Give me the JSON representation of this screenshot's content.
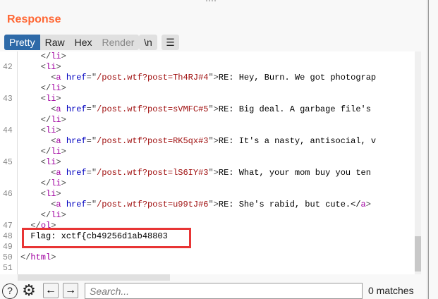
{
  "title": "Response",
  "tabs": [
    {
      "label": "Pretty",
      "state": "active"
    },
    {
      "label": "Raw",
      "state": "normal"
    },
    {
      "label": "Hex",
      "state": "normal"
    },
    {
      "label": "Render",
      "state": "disabled"
    }
  ],
  "newline_button": "\\n",
  "menu_icon": "hamburger-menu-icon",
  "lines": [
    {
      "num": "",
      "seg": [
        [
          "p",
          "    </"
        ],
        [
          "tag",
          "li"
        ],
        [
          "p",
          ">"
        ]
      ]
    },
    {
      "num": "42",
      "seg": [
        [
          "p",
          "    <"
        ],
        [
          "tag",
          "li"
        ],
        [
          "p",
          ">"
        ]
      ]
    },
    {
      "num": "",
      "seg": [
        [
          "p",
          "      <"
        ],
        [
          "tag",
          "a"
        ],
        [
          "p",
          " "
        ],
        [
          "attr",
          "href"
        ],
        [
          "p",
          "=\""
        ],
        [
          "str",
          "/post.wtf?post=Th4RJ#4"
        ],
        [
          "p",
          "\">"
        ],
        [
          "txt",
          "RE: Hey, Burn. We got photograp"
        ]
      ]
    },
    {
      "num": "",
      "seg": [
        [
          "p",
          "    </"
        ],
        [
          "tag",
          "li"
        ],
        [
          "p",
          ">"
        ]
      ]
    },
    {
      "num": "43",
      "seg": [
        [
          "p",
          "    <"
        ],
        [
          "tag",
          "li"
        ],
        [
          "p",
          ">"
        ]
      ]
    },
    {
      "num": "",
      "seg": [
        [
          "p",
          "      <"
        ],
        [
          "tag",
          "a"
        ],
        [
          "p",
          " "
        ],
        [
          "attr",
          "href"
        ],
        [
          "p",
          "=\""
        ],
        [
          "str",
          "/post.wtf?post=sVMFC#5"
        ],
        [
          "p",
          "\">"
        ],
        [
          "txt",
          "RE: Big deal. A garbage file's"
        ]
      ]
    },
    {
      "num": "",
      "seg": [
        [
          "p",
          "    </"
        ],
        [
          "tag",
          "li"
        ],
        [
          "p",
          ">"
        ]
      ]
    },
    {
      "num": "44",
      "seg": [
        [
          "p",
          "    <"
        ],
        [
          "tag",
          "li"
        ],
        [
          "p",
          ">"
        ]
      ]
    },
    {
      "num": "",
      "seg": [
        [
          "p",
          "      <"
        ],
        [
          "tag",
          "a"
        ],
        [
          "p",
          " "
        ],
        [
          "attr",
          "href"
        ],
        [
          "p",
          "=\""
        ],
        [
          "str",
          "/post.wtf?post=RK5qx#3"
        ],
        [
          "p",
          "\">"
        ],
        [
          "txt",
          "RE: It's a nasty, antisocial, v"
        ]
      ]
    },
    {
      "num": "",
      "seg": [
        [
          "p",
          "    </"
        ],
        [
          "tag",
          "li"
        ],
        [
          "p",
          ">"
        ]
      ]
    },
    {
      "num": "45",
      "seg": [
        [
          "p",
          "    <"
        ],
        [
          "tag",
          "li"
        ],
        [
          "p",
          ">"
        ]
      ]
    },
    {
      "num": "",
      "seg": [
        [
          "p",
          "      <"
        ],
        [
          "tag",
          "a"
        ],
        [
          "p",
          " "
        ],
        [
          "attr",
          "href"
        ],
        [
          "p",
          "=\""
        ],
        [
          "str",
          "/post.wtf?post=lS6IY#3"
        ],
        [
          "p",
          "\">"
        ],
        [
          "txt",
          "RE: What, your mom buy you ten"
        ]
      ]
    },
    {
      "num": "",
      "seg": [
        [
          "p",
          "    </"
        ],
        [
          "tag",
          "li"
        ],
        [
          "p",
          ">"
        ]
      ]
    },
    {
      "num": "46",
      "seg": [
        [
          "p",
          "    <"
        ],
        [
          "tag",
          "li"
        ],
        [
          "p",
          ">"
        ]
      ]
    },
    {
      "num": "",
      "seg": [
        [
          "p",
          "      <"
        ],
        [
          "tag",
          "a"
        ],
        [
          "p",
          " "
        ],
        [
          "attr",
          "href"
        ],
        [
          "p",
          "=\""
        ],
        [
          "str",
          "/post.wtf?post=u99tJ#6"
        ],
        [
          "p",
          "\">"
        ],
        [
          "txt",
          "RE: She's rabid, but cute.</"
        ],
        [
          "tag",
          "a"
        ],
        [
          "p",
          ">"
        ]
      ]
    },
    {
      "num": "",
      "seg": [
        [
          "p",
          "    </"
        ],
        [
          "tag",
          "li"
        ],
        [
          "p",
          ">"
        ]
      ]
    },
    {
      "num": "47",
      "seg": [
        [
          "p",
          "  </"
        ],
        [
          "tag",
          "ol"
        ],
        [
          "p",
          ">"
        ]
      ]
    },
    {
      "num": "48",
      "seg": [
        [
          "txt",
          "  Flag: xctf{cb49256d1ab48803"
        ]
      ]
    },
    {
      "num": "49",
      "seg": []
    },
    {
      "num": "50",
      "seg": [
        [
          "p",
          "</"
        ],
        [
          "tag",
          "html"
        ],
        [
          "p",
          ">"
        ]
      ]
    },
    {
      "num": "51",
      "seg": []
    }
  ],
  "footer": {
    "help_icon": "help-icon",
    "settings_icon": "gear-icon",
    "back": "←",
    "forward": "→",
    "search_placeholder": "Search...",
    "matches": "0 matches"
  },
  "colors": {
    "title": "#ff6633",
    "active_tab": "#2e6aa8",
    "highlight": "#e83535"
  }
}
